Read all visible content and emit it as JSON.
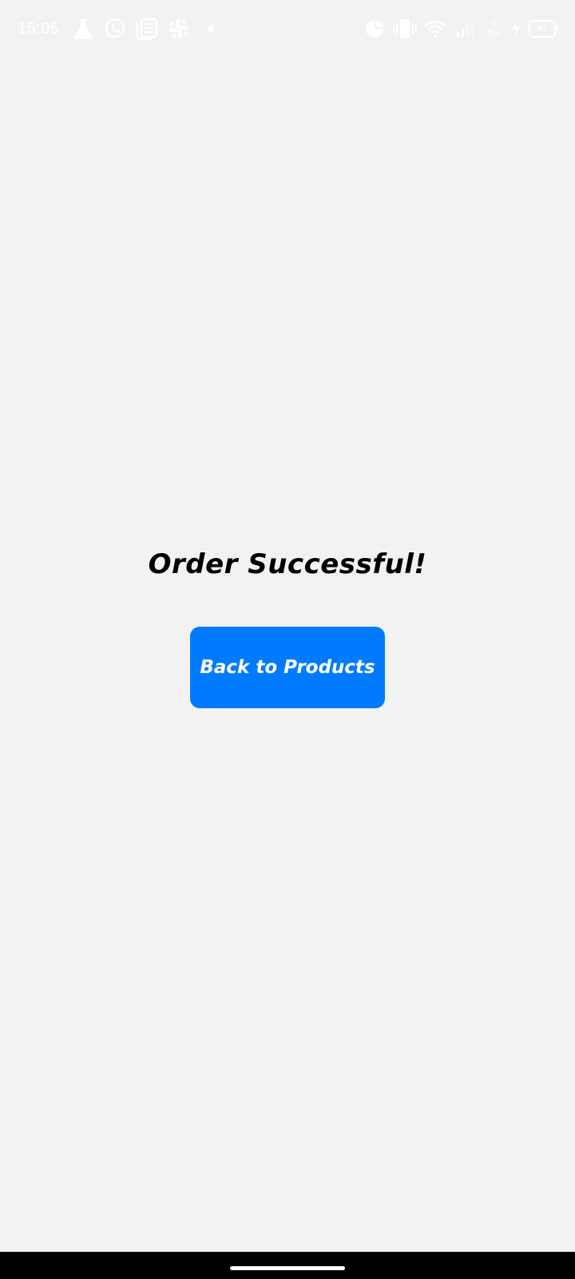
{
  "status_bar": {
    "time": "15:05",
    "left_icons": [
      "flask-icon",
      "whatsapp-icon",
      "news-icon",
      "slack-icon",
      "dot-icon"
    ],
    "right_icons": [
      "data-usage-icon",
      "vibrate-icon",
      "wifi-icon",
      "signal-icon",
      "charging-icon"
    ],
    "net_speed_value": "0",
    "net_speed_unit": "B/s",
    "battery_level": "41",
    "icon_color": "#ffffff"
  },
  "main": {
    "title": "Order Successful!",
    "back_button_label": "Back to Products",
    "button_color": "#007bff",
    "background_color": "#f2f2f2"
  }
}
